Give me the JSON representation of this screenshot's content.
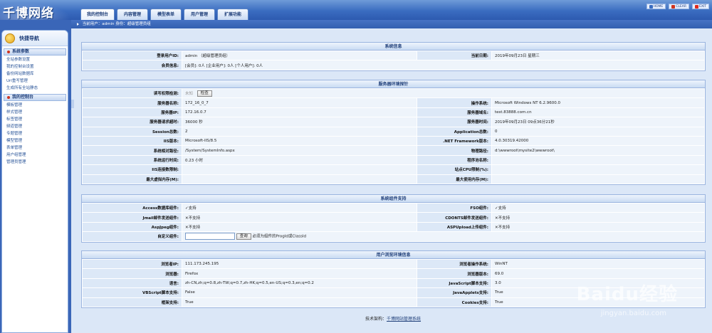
{
  "app": {
    "logo_text": "千博网络"
  },
  "tabs": [
    {
      "label": "我的控制台"
    },
    {
      "label": "内容管理"
    },
    {
      "label": "模型表单"
    },
    {
      "label": "用户管理"
    },
    {
      "label": "扩展功能"
    }
  ],
  "top_links": [
    {
      "label": "HOME",
      "icon": "home-icon",
      "color": "#3a6cc0"
    },
    {
      "label": "CLEAR",
      "icon": "clear-icon",
      "color": "#d0341f"
    },
    {
      "label": "EXIT",
      "icon": "exit-icon",
      "color": "#e12a1a"
    }
  ],
  "subbar": {
    "text": "当前用户：admin 身份：超级管理员组"
  },
  "sidebar": {
    "title": "快捷导航",
    "sections": [
      {
        "title": "系统参数",
        "items": [
          "全站参数设置",
          "我的控制台设置",
          "备份网站数据库",
          "Url重写管理",
          "生成所有全站静态"
        ]
      },
      {
        "title": "我的控制台",
        "items": [
          "模板管理",
          "样式管理",
          "标签管理",
          "频道管理",
          "专题管理",
          "模型管理",
          "表单管理",
          "用户组管理",
          "管理员管理"
        ]
      }
    ]
  },
  "system_info": {
    "title": "系统信息",
    "login_user_label": "登录用户ID:",
    "login_user_value": "admin （超级管理员组）",
    "current_date_label": "当前日期:",
    "current_date_value": "2019年09月23日 星期三",
    "member_label": "会员信息:",
    "member_value": "[会员]: 0人 [企业用户]: 0人 [个人用户]: 0人"
  },
  "server_probe": {
    "title": "服务器环境探针",
    "rw_label": "读写权限检测:",
    "rw_status": "未知",
    "rw_button": "检查",
    "rows": [
      {
        "l1": "服务器名称:",
        "v1": "172_16_0_7",
        "l2": "操作系统:",
        "v2": "Microsoft Windows NT 6.2.9600.0"
      },
      {
        "l1": "服务器IP:",
        "v1": "172.16.0.7",
        "l2": "服务器域名:",
        "v2": "test.83888.com.cn"
      },
      {
        "l1": "服务器请求超时:",
        "v1": "36000 秒",
        "l2": "服务器时间:",
        "v2": "2019年09月23日 09点36分21秒"
      },
      {
        "l1": "Session总数:",
        "v1": "2",
        "l2": "Application总数:",
        "v2": "0"
      },
      {
        "l1": "IIS版本:",
        "v1": "Microsoft-IIS/8.5",
        "l2": ".NET Framework版本:",
        "v2": "4.0.30319.42000"
      },
      {
        "l1": "系统相对路径:",
        "v1": "/System/SystemInfo.aspx",
        "l2": "物理路径:",
        "v2": "d:\\wwwroot\\mysite2\\wwwroot\\"
      },
      {
        "l1": "系统运行时间:",
        "v1": "0.23 小时",
        "l2": "程序池名称:",
        "v2": ""
      },
      {
        "l1": "IIS连接数限制:",
        "v1": "",
        "l2": "站点CPU限制(%):",
        "v2": ""
      },
      {
        "l1": "最大虚拟内存(M):",
        "v1": "",
        "l2": "最大使用内存(M):",
        "v2": ""
      }
    ]
  },
  "components": {
    "title": "系统组件支持",
    "rows": [
      {
        "l1": "Access数据库组件:",
        "v1": "✓支持",
        "s1": "ok",
        "l2": "FSO组件:",
        "v2": "✓支持",
        "s2": "ok"
      },
      {
        "l1": "Jmail邮件发送组件:",
        "v1": "✕不支持",
        "s1": "no",
        "l2": "CDONTS邮件发送组件:",
        "v2": "✕不支持",
        "s2": "no"
      },
      {
        "l1": "AspJpeg组件:",
        "v1": "✕不支持",
        "s1": "no",
        "l2": "ASPUpload上传组件:",
        "v2": "✕不支持",
        "s2": "no"
      }
    ],
    "custom_label": "自定义组件:",
    "custom_button": "查询",
    "custom_hint": "必须为组件的ProgId或ClassId"
  },
  "browser_info": {
    "title": "用户浏览环境信息",
    "rows": [
      {
        "l1": "浏览者IP:",
        "v1": "111.173.245.195",
        "l2": "浏览者操作系统:",
        "v2": "WinNT"
      },
      {
        "l1": "浏览器:",
        "v1": "Firefox",
        "l2": "浏览器版本:",
        "v2": "69.0"
      },
      {
        "l1": "语言:",
        "v1": "zh-CN,zh;q=0.8,zh-TW;q=0.7,zh-HK;q=0.5,en-US;q=0.3,en;q=0.2",
        "l2": "JavaScript脚本支持:",
        "v2": "3.0"
      },
      {
        "l1": "VBScript脚本支持:",
        "v1": "False",
        "l2": "JavaApplets支持:",
        "v2": "True"
      },
      {
        "l1": "框架支持:",
        "v1": "True",
        "l2": "Cookies支持:",
        "v2": "True"
      }
    ]
  },
  "footer": {
    "prefix": "技术架构：",
    "link": "千博网站管理系统"
  },
  "watermark": {
    "main": "Baidu经验",
    "sub": "jingyan.baidu.com"
  }
}
